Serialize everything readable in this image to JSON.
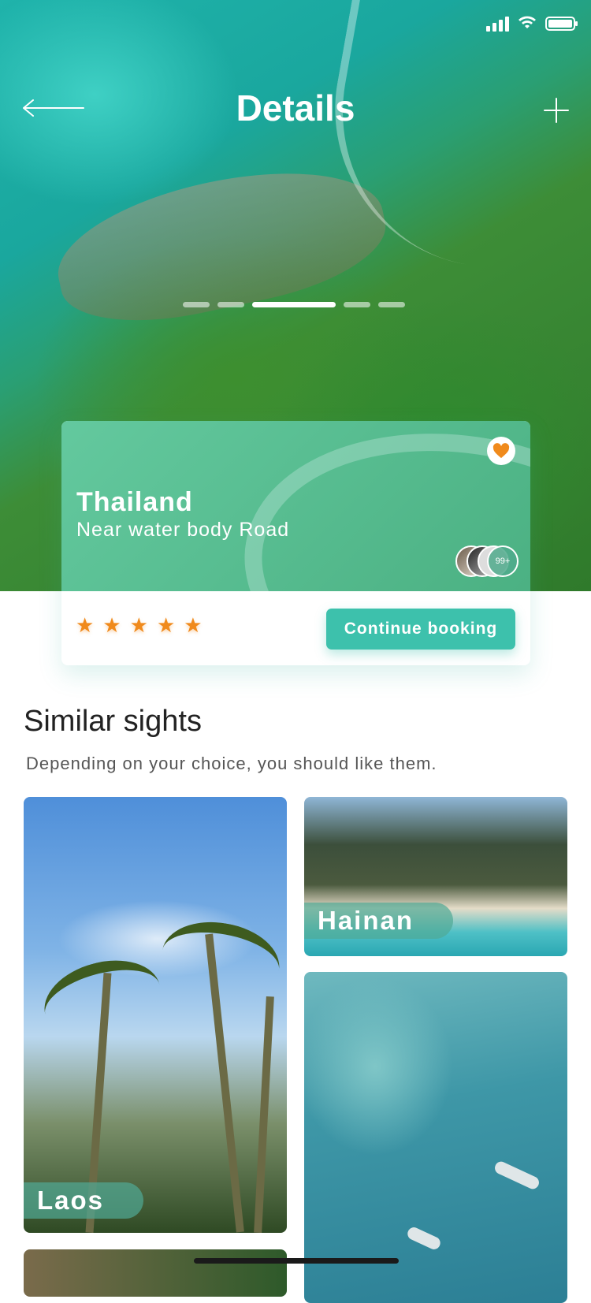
{
  "header": {
    "title": "Details"
  },
  "icons": {
    "back": "arrow-left-icon",
    "add": "plus-icon",
    "favorite": "heart-icon",
    "rating": "star-icon"
  },
  "carousel": {
    "page_count": 5,
    "active_index": 2
  },
  "featured": {
    "title": "Thailand",
    "subtitle": "Near water body Road",
    "visitors_badge": "99+",
    "rating_stars": 5,
    "cta_label": "Continue booking"
  },
  "similar": {
    "title": "Similar sights",
    "subtitle": "Depending on your choice, you should like them.",
    "items": [
      {
        "label": "Laos"
      },
      {
        "label": "Hainan"
      }
    ]
  },
  "colors": {
    "accent": "#3dc1ac",
    "star": "#f08a1c",
    "text": "#222222"
  }
}
